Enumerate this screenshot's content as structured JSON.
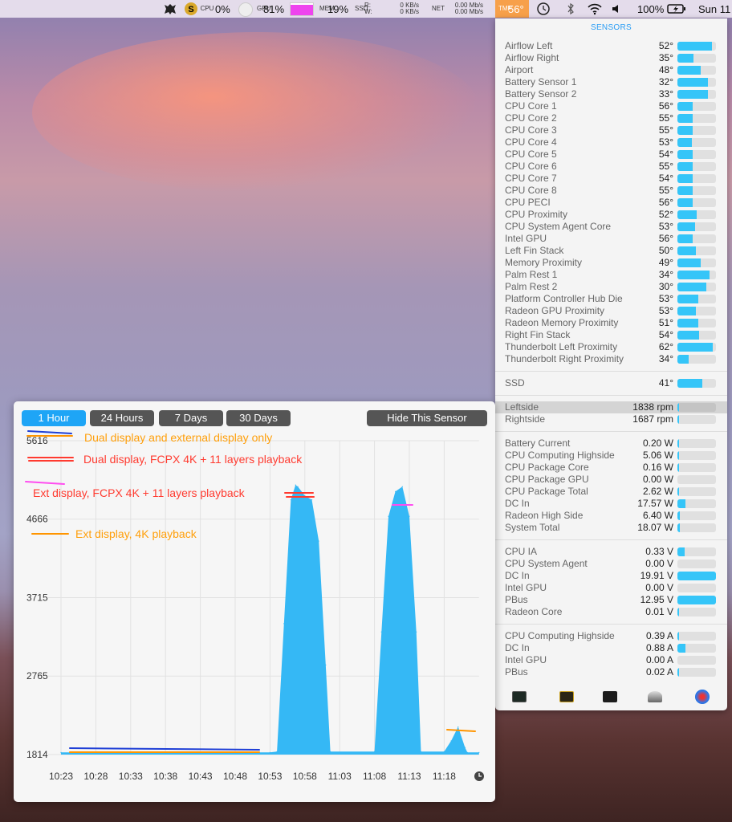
{
  "menubar": {
    "cpu_label": "CPU",
    "cpu_value": "0%",
    "gpu_label": "GPU",
    "gpu_value": "81%",
    "mem_label": "MEM",
    "mem_value": "19%",
    "ssd_label": "SSD",
    "disk_r_label": "R:",
    "disk_w_label": "W:",
    "disk_r": "0 KB/s",
    "disk_w": "0 KB/s",
    "net_label": "NET",
    "net_up": "0.00 Mb/s",
    "net_down": "0.00 Mb/s",
    "temp_label": "TMP",
    "temp": "56°",
    "battery": "100%",
    "clock": "Sun 11",
    "gpu_fill": 0.81,
    "icons": [
      "app-icon",
      "s-icon",
      "time-machine-icon",
      "bluetooth-icon",
      "wifi-icon",
      "volume-icon",
      "battery-charging-icon"
    ]
  },
  "sensors": {
    "title": "SENSORS",
    "temperatures": [
      {
        "name": "Airflow Left",
        "value": "52°",
        "fill": 0.9
      },
      {
        "name": "Airflow Right",
        "value": "35°",
        "fill": 0.42
      },
      {
        "name": "Airport",
        "value": "48°",
        "fill": 0.6
      },
      {
        "name": "Battery Sensor 1",
        "value": "32°",
        "fill": 0.8
      },
      {
        "name": "Battery Sensor 2",
        "value": "33°",
        "fill": 0.8
      },
      {
        "name": "CPU Core 1",
        "value": "56°",
        "fill": 0.4
      },
      {
        "name": "CPU Core 2",
        "value": "55°",
        "fill": 0.4
      },
      {
        "name": "CPU Core 3",
        "value": "55°",
        "fill": 0.4
      },
      {
        "name": "CPU Core 4",
        "value": "53°",
        "fill": 0.38
      },
      {
        "name": "CPU Core 5",
        "value": "54°",
        "fill": 0.4
      },
      {
        "name": "CPU Core 6",
        "value": "55°",
        "fill": 0.4
      },
      {
        "name": "CPU Core 7",
        "value": "54°",
        "fill": 0.4
      },
      {
        "name": "CPU Core 8",
        "value": "55°",
        "fill": 0.4
      },
      {
        "name": "CPU PECI",
        "value": "56°",
        "fill": 0.4
      },
      {
        "name": "CPU Proximity",
        "value": "52°",
        "fill": 0.5
      },
      {
        "name": "CPU System Agent Core",
        "value": "53°",
        "fill": 0.45
      },
      {
        "name": "Intel GPU",
        "value": "56°",
        "fill": 0.4
      },
      {
        "name": "Left Fin Stack",
        "value": "50°",
        "fill": 0.48
      },
      {
        "name": "Memory Proximity",
        "value": "49°",
        "fill": 0.6
      },
      {
        "name": "Palm Rest 1",
        "value": "34°",
        "fill": 0.83
      },
      {
        "name": "Palm Rest 2",
        "value": "30°",
        "fill": 0.75
      },
      {
        "name": "Platform Controller Hub Die",
        "value": "53°",
        "fill": 0.55
      },
      {
        "name": "Radeon GPU Proximity",
        "value": "53°",
        "fill": 0.48
      },
      {
        "name": "Radeon Memory Proximity",
        "value": "51°",
        "fill": 0.55
      },
      {
        "name": "Right Fin Stack",
        "value": "54°",
        "fill": 0.57
      },
      {
        "name": "Thunderbolt Left Proximity",
        "value": "62°",
        "fill": 0.92
      },
      {
        "name": "Thunderbolt Right Proximity",
        "value": "34°",
        "fill": 0.3
      }
    ],
    "disks": [
      {
        "name": "SSD",
        "value": "41°",
        "fill": 0.65
      }
    ],
    "fans": [
      {
        "name": "Leftside",
        "value": "1838 rpm",
        "fill": 0.02
      },
      {
        "name": "Rightside",
        "value": "1687 rpm",
        "fill": 0.02
      }
    ],
    "power": [
      {
        "name": "Battery Current",
        "value": "0.20 W",
        "fill": 0.03
      },
      {
        "name": "CPU Computing Highside",
        "value": "5.06 W",
        "fill": 0.03
      },
      {
        "name": "CPU Package Core",
        "value": "0.16 W",
        "fill": 0.03
      },
      {
        "name": "CPU Package GPU",
        "value": "0.00 W",
        "fill": 0.0
      },
      {
        "name": "CPU Package Total",
        "value": "2.62 W",
        "fill": 0.03
      },
      {
        "name": "DC In",
        "value": "17.57 W",
        "fill": 0.2
      },
      {
        "name": "Radeon High Side",
        "value": "6.40 W",
        "fill": 0.06
      },
      {
        "name": "System Total",
        "value": "18.07 W",
        "fill": 0.06
      }
    ],
    "voltage": [
      {
        "name": "CPU IA",
        "value": "0.33 V",
        "fill": 0.18
      },
      {
        "name": "CPU System Agent",
        "value": "0.00 V",
        "fill": 0.0
      },
      {
        "name": "DC In",
        "value": "19.91 V",
        "fill": 1.0
      },
      {
        "name": "Intel GPU",
        "value": "0.00 V",
        "fill": 0.0
      },
      {
        "name": "PBus",
        "value": "12.95 V",
        "fill": 1.0
      },
      {
        "name": "Radeon Core",
        "value": "0.01 V",
        "fill": 0.02
      }
    ],
    "current": [
      {
        "name": "CPU Computing Highside",
        "value": "0.39 A",
        "fill": 0.03
      },
      {
        "name": "DC In",
        "value": "0.88 A",
        "fill": 0.2
      },
      {
        "name": "Intel GPU",
        "value": "0.00 A",
        "fill": 0.0
      },
      {
        "name": "PBus",
        "value": "0.02 A",
        "fill": 0.03
      }
    ],
    "dock_icons": [
      "activity-monitor-icon",
      "console-icon",
      "terminal-icon",
      "system-information-icon",
      "istat-menus-icon"
    ]
  },
  "history": {
    "ranges": [
      "1 Hour",
      "24 Hours",
      "7 Days",
      "30 Days"
    ],
    "active_range": "1 Hour",
    "hide_label": "Hide This Sensor",
    "annotations": [
      {
        "text": "Dual display and external display only",
        "color": "#ff9f0a"
      },
      {
        "text": "Dual display, FCPX 4K + 11 layers playback",
        "color": "#ff3b30"
      },
      {
        "text": "Ext display, FCPX 4K + 11 layers playback",
        "color": "#ff3b30"
      },
      {
        "text": "Ext display, 4K playback",
        "color": "#ff9f0a"
      }
    ],
    "annotation_line_colors": {
      "blue": "#1f3fd6",
      "orange": "#ff9500",
      "red": "#ff3b30",
      "magenta": "#ff4df0"
    }
  },
  "chart_data": {
    "type": "area",
    "color": "#35b8f5",
    "ylim": [
      1814,
      5616
    ],
    "yticks": [
      "1814",
      "2765",
      "3715",
      "4666",
      "5616"
    ],
    "xticks": [
      "10:23",
      "10:28",
      "10:33",
      "10:38",
      "10:43",
      "10:48",
      "10:53",
      "10:58",
      "11:03",
      "11:08",
      "11:13",
      "11:18"
    ],
    "xlim": [
      "10:23",
      "11:23"
    ],
    "points": [
      [
        "10:23",
        1840
      ],
      [
        "10:53",
        1840
      ],
      [
        "10:54",
        1850
      ],
      [
        "10:55",
        3400
      ],
      [
        "10:56",
        4900
      ],
      [
        "10:56:40",
        5080
      ],
      [
        "10:57",
        5060
      ],
      [
        "10:58",
        4950
      ],
      [
        "10:59",
        4900
      ],
      [
        "11:00",
        4400
      ],
      [
        "11:01",
        2900
      ],
      [
        "11:01:40",
        1850
      ],
      [
        "11:08",
        1850
      ],
      [
        "11:09",
        3300
      ],
      [
        "11:10",
        4700
      ],
      [
        "11:11",
        5000
      ],
      [
        "11:12",
        5060
      ],
      [
        "11:13",
        4700
      ],
      [
        "11:14",
        3300
      ],
      [
        "11:14:40",
        1850
      ],
      [
        "11:18",
        1850
      ],
      [
        "11:19",
        1980
      ],
      [
        "11:20",
        2150
      ],
      [
        "11:21",
        1900
      ],
      [
        "11:21:20",
        1840
      ],
      [
        "11:23",
        1840
      ]
    ]
  }
}
